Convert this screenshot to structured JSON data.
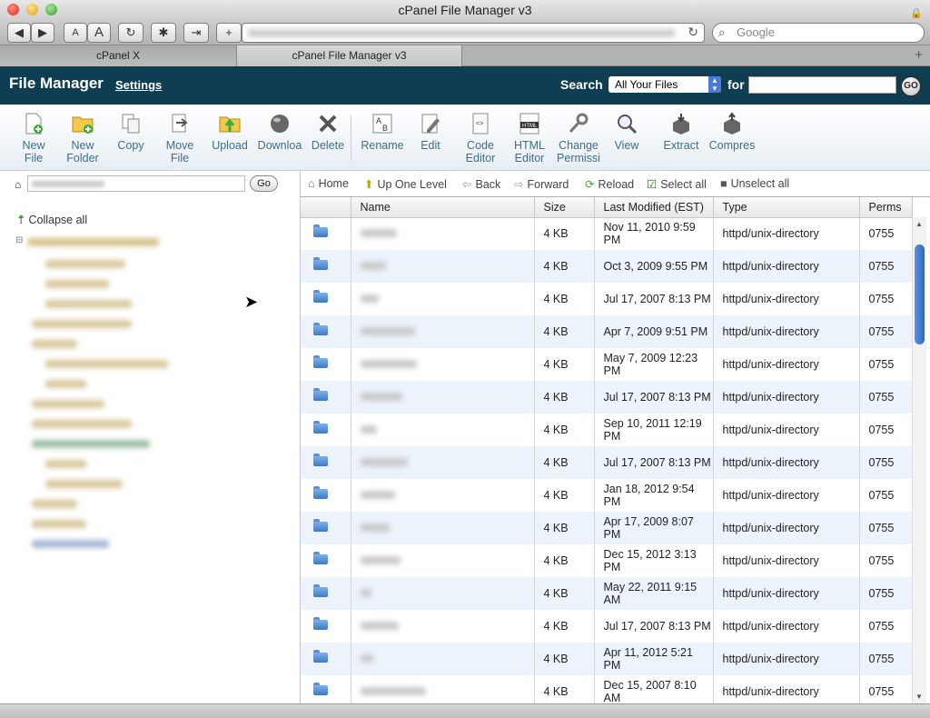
{
  "window": {
    "title": "cPanel File Manager v3"
  },
  "browser": {
    "search_placeholder": "Google",
    "tabs": [
      {
        "label": "cPanel X"
      },
      {
        "label": "cPanel File Manager v3"
      }
    ]
  },
  "header": {
    "title": "File Manager",
    "settings_label": "Settings",
    "search_label": "Search",
    "search_scope": "All Your Files",
    "for_label": "for",
    "go_label": "GO"
  },
  "actions": [
    {
      "label": "New\nFile",
      "icon": "new-file-icon"
    },
    {
      "label": "New\nFolder",
      "icon": "new-folder-icon"
    },
    {
      "label": "Copy",
      "icon": "copy-icon"
    },
    {
      "label": "Move\nFile",
      "icon": "move-file-icon"
    },
    {
      "label": "Upload",
      "icon": "upload-icon"
    },
    {
      "label": "Downloa",
      "icon": "download-icon"
    },
    {
      "label": "Delete",
      "icon": "delete-icon"
    },
    {
      "label": "Rename",
      "icon": "rename-icon"
    },
    {
      "label": "Edit",
      "icon": "edit-icon"
    },
    {
      "label": "Code\nEditor",
      "icon": "code-editor-icon"
    },
    {
      "label": "HTML\nEditor",
      "icon": "html-editor-icon"
    },
    {
      "label": "Change\nPermissi",
      "icon": "permissions-icon"
    },
    {
      "label": "View",
      "icon": "view-icon"
    },
    {
      "label": "Extract",
      "icon": "extract-icon"
    },
    {
      "label": "Compres",
      "icon": "compress-icon"
    }
  ],
  "left": {
    "go_label": "Go",
    "collapse_label": "Collapse all"
  },
  "nav": {
    "home": "Home",
    "up": "Up One Level",
    "back": "Back",
    "forward": "Forward",
    "reload": "Reload",
    "select_all": "Select all",
    "unselect_all": "Unselect all"
  },
  "table": {
    "columns": [
      "Name",
      "Size",
      "Last Modified (EST)",
      "Type",
      "Perms"
    ],
    "rows": [
      {
        "size": "4 KB",
        "modified": "Nov 11, 2010 9:59 PM",
        "type": "httpd/unix-directory",
        "perms": "0755"
      },
      {
        "size": "4 KB",
        "modified": "Oct 3, 2009 9:55 PM",
        "type": "httpd/unix-directory",
        "perms": "0755"
      },
      {
        "size": "4 KB",
        "modified": "Jul 17, 2007 8:13 PM",
        "type": "httpd/unix-directory",
        "perms": "0755"
      },
      {
        "size": "4 KB",
        "modified": "Apr 7, 2009 9:51 PM",
        "type": "httpd/unix-directory",
        "perms": "0755"
      },
      {
        "size": "4 KB",
        "modified": "May 7, 2009 12:23 PM",
        "type": "httpd/unix-directory",
        "perms": "0755"
      },
      {
        "size": "4 KB",
        "modified": "Jul 17, 2007 8:13 PM",
        "type": "httpd/unix-directory",
        "perms": "0755"
      },
      {
        "size": "4 KB",
        "modified": "Sep 10, 2011 12:19 PM",
        "type": "httpd/unix-directory",
        "perms": "0755"
      },
      {
        "size": "4 KB",
        "modified": "Jul 17, 2007 8:13 PM",
        "type": "httpd/unix-directory",
        "perms": "0755"
      },
      {
        "size": "4 KB",
        "modified": "Jan 18, 2012 9:54 PM",
        "type": "httpd/unix-directory",
        "perms": "0755"
      },
      {
        "size": "4 KB",
        "modified": "Apr 17, 2009 8:07 PM",
        "type": "httpd/unix-directory",
        "perms": "0755"
      },
      {
        "size": "4 KB",
        "modified": "Dec 15, 2012 3:13 PM",
        "type": "httpd/unix-directory",
        "perms": "0755"
      },
      {
        "size": "4 KB",
        "modified": "May 22, 2011 9:15 AM",
        "type": "httpd/unix-directory",
        "perms": "0755"
      },
      {
        "size": "4 KB",
        "modified": "Jul 17, 2007 8:13 PM",
        "type": "httpd/unix-directory",
        "perms": "0755"
      },
      {
        "size": "4 KB",
        "modified": "Apr 11, 2012 5:21 PM",
        "type": "httpd/unix-directory",
        "perms": "0755"
      },
      {
        "size": "4 KB",
        "modified": "Dec 15, 2007 8:10 AM",
        "type": "httpd/unix-directory",
        "perms": "0755"
      }
    ]
  },
  "colors": {
    "header_bg": "#0f3d52",
    "action_text": "#3a6e8c",
    "row_alt": "#edf3fb"
  }
}
